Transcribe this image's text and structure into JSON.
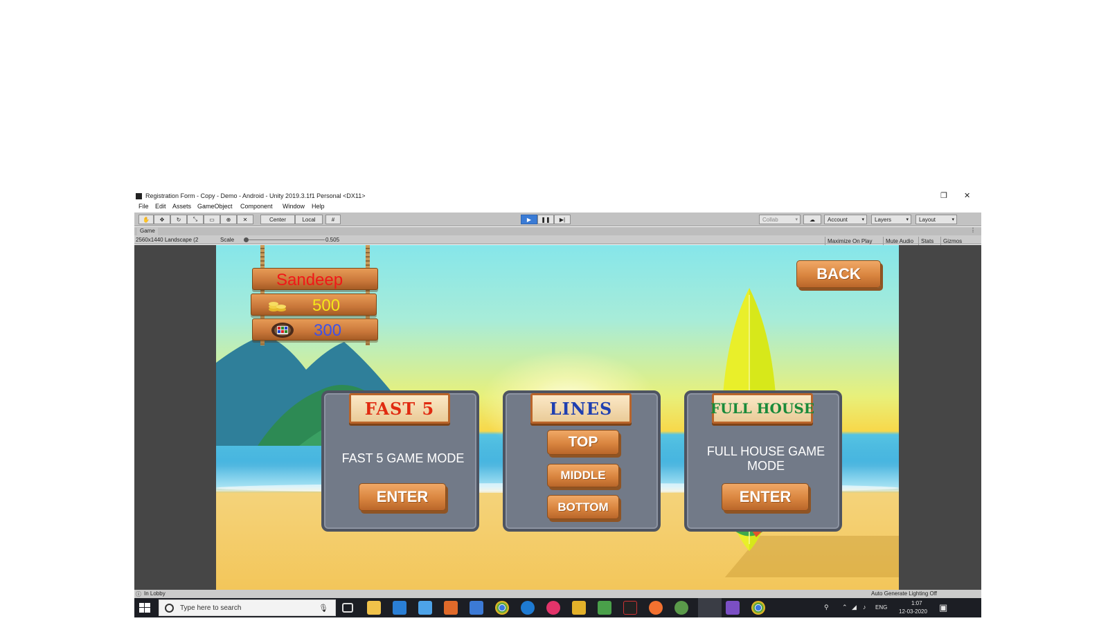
{
  "window": {
    "title": "Registration Form - Copy - Demo - Android - Unity 2019.3.1f1 Personal <DX11>",
    "controls": {
      "restore": "❐",
      "close": "✕"
    }
  },
  "menu": [
    "File",
    "Edit",
    "Assets",
    "GameObject",
    "Component",
    "Window",
    "Help"
  ],
  "toolbar": {
    "tools": [
      "hand-tool",
      "move-tool",
      "rotate-tool",
      "scale-tool",
      "rect-tool",
      "transform-tool",
      "custom-tool"
    ],
    "pivot_label": "Center",
    "space_label": "Local",
    "collab_label": "Collab",
    "account_label": "Account",
    "layers_label": "Layers",
    "layout_label": "Layout"
  },
  "game_view": {
    "tab_label": "Game",
    "resolution": "2560x1440 Landscape (2",
    "scale_label": "Scale",
    "scale_value": "0.505",
    "maximize_on_play": "Maximize On Play",
    "mute_audio": "Mute Audio",
    "stats": "Stats",
    "gizmos": "Gizmos"
  },
  "game": {
    "player_name": "Sandeep",
    "coins": "500",
    "tickets": "300",
    "back_label": "BACK",
    "modes": [
      {
        "title": "FAST 5",
        "title_color": "#e02a10",
        "description": "FAST 5 GAME MODE",
        "button": "ENTER"
      },
      {
        "title": "LINES",
        "title_color": "#1f3fb0",
        "buttons": [
          "TOP",
          "MIDDLE",
          "BOTTOM"
        ]
      },
      {
        "title": "FULL HOUSE",
        "title_color": "#1a8a3a",
        "description": "FULL HOUSE GAME MODE",
        "button": "ENTER"
      }
    ],
    "colors": {
      "name": "#f01818",
      "coins": "#f5e61a",
      "tickets": "#3f52e6"
    }
  },
  "status": {
    "left": "In Lobby",
    "right": "Auto Generate Lighting Off"
  },
  "taskbar": {
    "search_placeholder": "Type here to search",
    "language": "ENG",
    "time": "1:07",
    "date": "12-03-2020"
  }
}
